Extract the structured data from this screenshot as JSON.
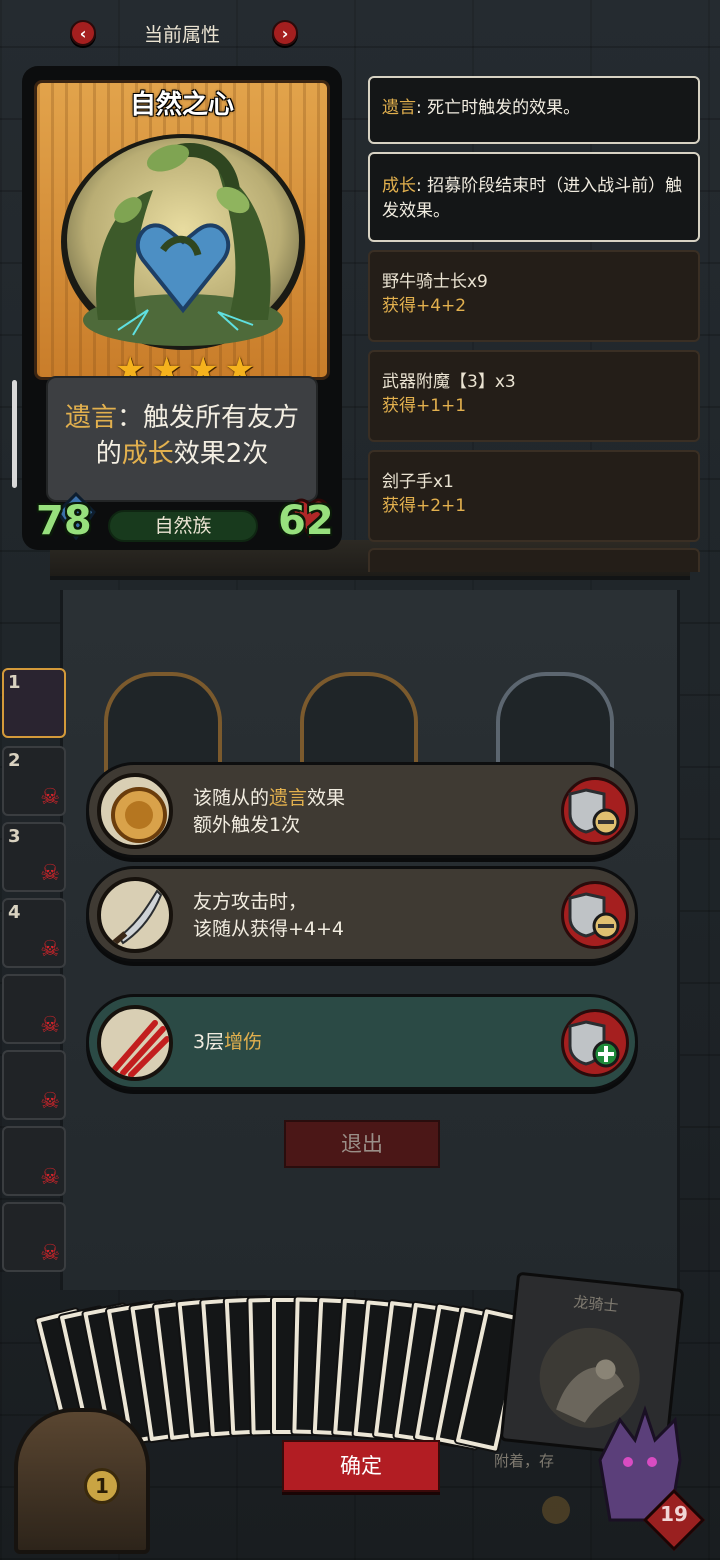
{
  "header": {
    "title": "当前属性",
    "prev_icon": "chevron-left-icon",
    "next_icon": "chevron-right-icon"
  },
  "card": {
    "name": "自然之心",
    "stars": 4,
    "ability_parts": [
      "遗言",
      "：触发所有友方的",
      "成长",
      "效果2次"
    ],
    "attack": "78",
    "health": "62",
    "tribe": "自然族"
  },
  "glossary": [
    {
      "keyword": "遗言",
      "text": ": 死亡时触发的效果。"
    },
    {
      "keyword": "成长",
      "text": ": 招募阶段结束时（进入战斗前）触发效果。"
    }
  ],
  "sources": [
    {
      "name": "野牛骑士长x9",
      "gain": "获得+4+2"
    },
    {
      "name": "武器附魔【3】x3",
      "gain": "获得+1+1"
    },
    {
      "name": "刽子手x1",
      "gain": "获得+2+1"
    }
  ],
  "side_slots": [
    {
      "num": "1",
      "state": "active"
    },
    {
      "num": "2",
      "state": "dead"
    },
    {
      "num": "3",
      "state": "dead"
    },
    {
      "num": "4",
      "state": "dead"
    },
    {
      "num": "",
      "state": "dead"
    },
    {
      "num": "",
      "state": "dead"
    },
    {
      "num": "",
      "state": "dead"
    },
    {
      "num": "",
      "state": "dead"
    }
  ],
  "buffs": [
    {
      "line1_pre": "该随从的",
      "keyword": "遗言",
      "line1_post": "效果",
      "line2": "额外触发1次",
      "icon": "coin-medallion-icon",
      "action": "remove",
      "action_icon": "shield-minus-icon"
    },
    {
      "line1_pre": "友方攻击时，",
      "keyword": "",
      "line1_post": "",
      "line2": "该随从获得+4+4",
      "icon": "scimitar-icon",
      "action": "remove",
      "action_icon": "shield-minus-icon"
    },
    {
      "line1_pre": "3层",
      "keyword": "增伤",
      "line1_post": "",
      "line2": "",
      "icon": "claw-slash-icon",
      "action": "add",
      "action_icon": "shield-plus-icon"
    }
  ],
  "exit_label": "退出",
  "confirm_label": "确定",
  "hand": {
    "featured_card_name": "龙骑士",
    "featured_card_desc": "附着，存",
    "gold": "1",
    "deck_count": "19"
  },
  "colors": {
    "keyword": "#e2b04e",
    "button_red": "#b21d23",
    "stat_green": "#97e07d",
    "tribe_green": "#183a1d"
  }
}
